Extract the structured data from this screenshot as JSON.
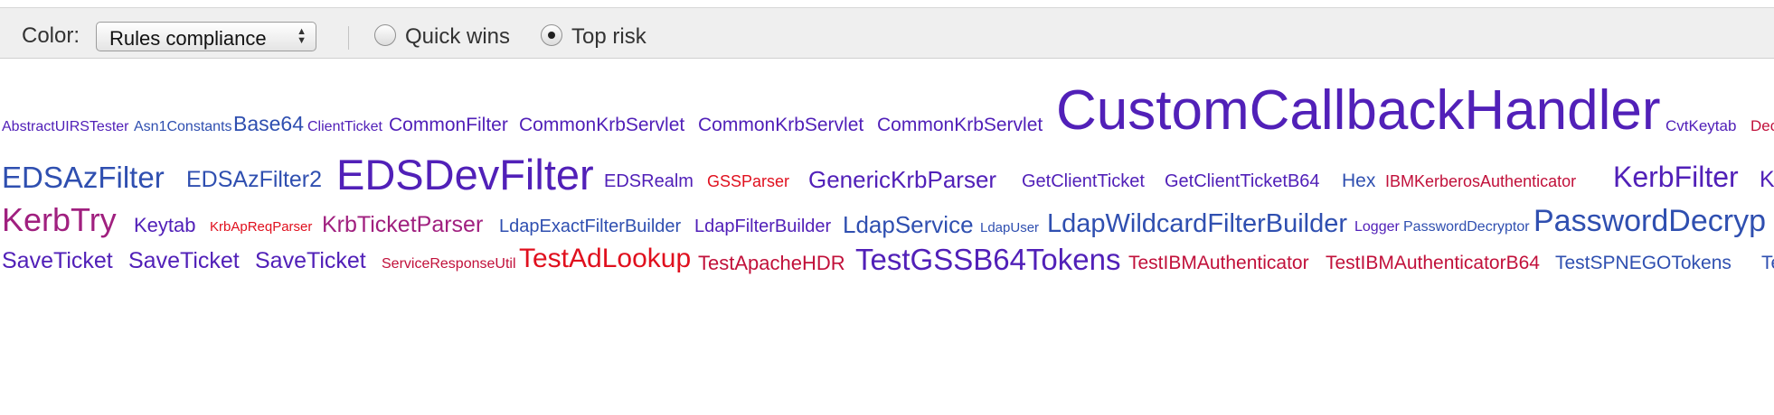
{
  "toolbar": {
    "color_label": "Color:",
    "color_select_value": "Rules compliance",
    "radio_quick_wins": "Quick wins",
    "radio_top_risk": "Top risk",
    "selected_radio": "Top risk"
  },
  "colors": {
    "purple": "#5120b8",
    "blue": "#2f4fb0",
    "red": "#e0101e",
    "crimson": "#c1103a",
    "magenta": "#a0207f"
  },
  "cloud": [
    {
      "t": "AbstractUIRSTester"
    },
    {
      "t": "Asn1Constants"
    },
    {
      "t": "Base64"
    },
    {
      "t": "ClientTicket"
    },
    {
      "t": "CommonFilter"
    },
    {
      "t": "CommonKrbServlet"
    },
    {
      "t": "CommonKrbServlet"
    },
    {
      "t": "CommonKrbServlet"
    },
    {
      "t": "CustomCallbackHandler"
    },
    {
      "t": "CvtKeytab"
    },
    {
      "t": "Dec"
    },
    {
      "t": "EDSAzFilter"
    },
    {
      "t": "EDSAzFilter2"
    },
    {
      "t": "EDSDevFilter"
    },
    {
      "t": "EDSRealm"
    },
    {
      "t": "GSSParser"
    },
    {
      "t": "GenericKrbParser"
    },
    {
      "t": "GetClientTicket"
    },
    {
      "t": "GetClientTicketB64"
    },
    {
      "t": "Hex"
    },
    {
      "t": "IBMKerberosAuthenticator"
    },
    {
      "t": "KerbFilter"
    },
    {
      "t": "K"
    },
    {
      "t": "KerbTry"
    },
    {
      "t": "Keytab"
    },
    {
      "t": "KrbApReqParser"
    },
    {
      "t": "KrbTicketParser"
    },
    {
      "t": "LdapExactFilterBuilder"
    },
    {
      "t": "LdapFilterBuilder"
    },
    {
      "t": "LdapService"
    },
    {
      "t": "LdapUser"
    },
    {
      "t": "LdapWildcardFilterBuilder"
    },
    {
      "t": "Logger"
    },
    {
      "t": "PasswordDecryptor"
    },
    {
      "t": "PasswordDecryp"
    },
    {
      "t": "SaveTicket"
    },
    {
      "t": "SaveTicket"
    },
    {
      "t": "SaveTicket"
    },
    {
      "t": "ServiceResponseUtil"
    },
    {
      "t": "TestAdLookup"
    },
    {
      "t": "TestApacheHDR"
    },
    {
      "t": "TestGSSB64Tokens"
    },
    {
      "t": "TestIBMAuthenticator"
    },
    {
      "t": "TestIBMAuthenticatorB64"
    },
    {
      "t": "TestSPNEGOTokens"
    },
    {
      "t": "Te"
    }
  ]
}
